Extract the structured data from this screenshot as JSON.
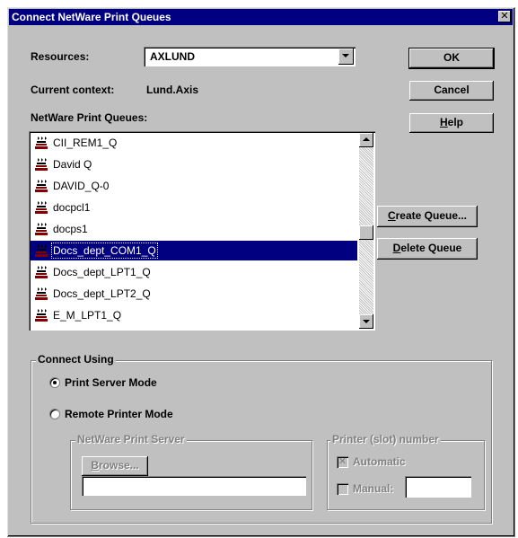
{
  "window": {
    "title": "Connect NetWare Print Queues",
    "close_glyph": "✕"
  },
  "resources": {
    "label": "Resources:",
    "value": "AXLUND"
  },
  "context": {
    "label": "Current context:",
    "value": "Lund.Axis"
  },
  "queues": {
    "label": "NetWare Print Queues:",
    "items": [
      {
        "label": "CII_REM1_Q",
        "icon": "print-queue-icon"
      },
      {
        "label": "David Q",
        "icon": "print-queue-icon"
      },
      {
        "label": "DAVID_Q-0",
        "icon": "print-queue-icon"
      },
      {
        "label": "docpcl1",
        "icon": "print-queue-icon"
      },
      {
        "label": "docps1",
        "icon": "print-queue-icon"
      },
      {
        "label": "Docs_dept_COM1_Q",
        "icon": "print-queue-icon",
        "selected": true
      },
      {
        "label": "Docs_dept_LPT1_Q",
        "icon": "print-queue-icon"
      },
      {
        "label": "Docs_dept_LPT2_Q",
        "icon": "print-queue-icon"
      },
      {
        "label": "E_M_LPT1_Q",
        "icon": "print-queue-icon"
      }
    ]
  },
  "buttons": {
    "ok": "OK",
    "cancel": "Cancel",
    "help_pre": "",
    "help_ul": "H",
    "help_post": "elp",
    "create_ul": "C",
    "create_post": "reate Queue...",
    "delete_ul": "D",
    "delete_post": "elete Queue",
    "browse_ul": "B",
    "browse_post": "rowse..."
  },
  "connect_using": {
    "title": "Connect Using",
    "print_server_mode": "Print Server Mode",
    "remote_printer_mode": "Remote Printer Mode",
    "selected_mode": "Print Server Mode"
  },
  "netware_print_server": {
    "title": "NetWare Print Server",
    "value": ""
  },
  "printer_slot": {
    "title": "Printer (slot) number",
    "automatic": "Automatic",
    "automatic_checked": true,
    "manual": "Manual:",
    "manual_checked": false,
    "manual_value": ""
  },
  "colors": {
    "face": "#c0c0c0",
    "title_bar": "#000080",
    "selection": "#000080"
  }
}
